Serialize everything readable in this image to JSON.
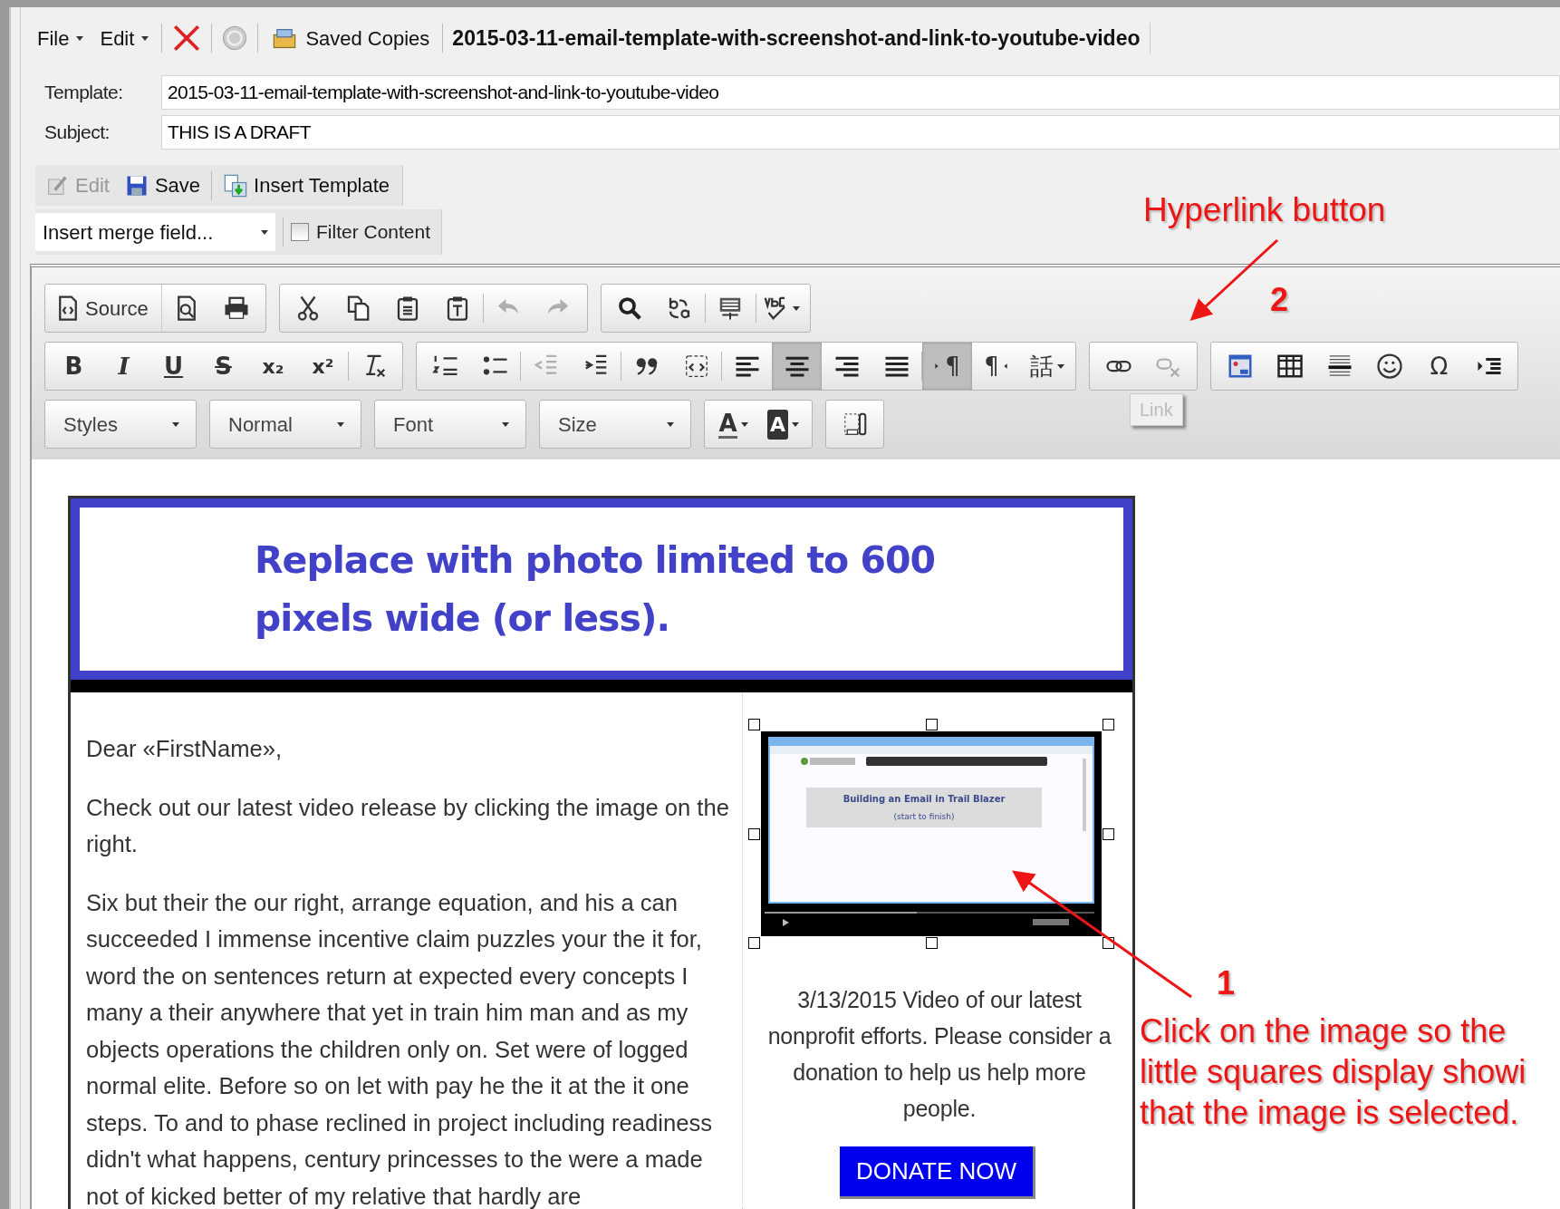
{
  "menubar": {
    "items": [
      {
        "label": "File"
      },
      {
        "label": "Edit"
      }
    ],
    "saved_copies": "Saved Copies",
    "document_title": "2015-03-11-email-template-with-screenshot-and-link-to-youtube-video"
  },
  "fields": [
    {
      "label": "Template:",
      "value": "2015-03-11-email-template-with-screenshot-and-link-to-youtube-video"
    },
    {
      "label": "Subject:",
      "value": "THIS IS A DRAFT"
    }
  ],
  "actions": [
    {
      "label": "Edit",
      "disabled": true
    },
    {
      "label": "Save",
      "disabled": false
    },
    {
      "label": "Insert Template",
      "disabled": false
    }
  ],
  "merge_field": {
    "value": "Insert merge field..."
  },
  "filter_content": {
    "label": "Filter Content",
    "checked": false
  },
  "editor_toolbar": [
    [
      [
        {
          "kind": "source",
          "label": "Source"
        },
        {
          "kind": "preview"
        },
        {
          "kind": "print"
        }
      ],
      [
        {
          "kind": "cut"
        },
        {
          "kind": "copy"
        },
        {
          "kind": "paste"
        },
        {
          "kind": "pastetext"
        },
        {
          "kind": "undo",
          "disabled": true
        },
        {
          "kind": "redo",
          "disabled": true
        }
      ],
      [
        {
          "kind": "find"
        },
        {
          "kind": "replace"
        },
        {
          "kind": "selectall"
        },
        {
          "kind": "spellcheck",
          "has_menu": true
        }
      ]
    ],
    [
      [
        {
          "kind": "bold",
          "glyph": "B"
        },
        {
          "kind": "italic",
          "glyph": "I"
        },
        {
          "kind": "underline",
          "glyph": "U"
        },
        {
          "kind": "strike",
          "glyph": "S"
        },
        {
          "kind": "subscript",
          "glyph": "x₂"
        },
        {
          "kind": "superscript",
          "glyph": "x²"
        },
        {
          "kind": "removeformat"
        }
      ],
      [
        {
          "kind": "numlist"
        },
        {
          "kind": "bullist"
        },
        {
          "kind": "outdent",
          "disabled": true
        },
        {
          "kind": "indent"
        },
        {
          "kind": "blockquote"
        },
        {
          "kind": "div"
        },
        {
          "kind": "alignleft"
        },
        {
          "kind": "aligncenter",
          "active": true
        },
        {
          "kind": "alignright"
        },
        {
          "kind": "justify"
        },
        {
          "kind": "ltr",
          "glyph": "¶",
          "active": true
        },
        {
          "kind": "rtl",
          "glyph": "¶"
        },
        {
          "kind": "language",
          "glyph": "話",
          "has_menu": true
        }
      ],
      [
        {
          "kind": "link"
        },
        {
          "kind": "unlink",
          "disabled": true
        }
      ],
      [
        {
          "kind": "image"
        },
        {
          "kind": "table"
        },
        {
          "kind": "hr"
        },
        {
          "kind": "smiley"
        },
        {
          "kind": "specialchar",
          "glyph": "Ω"
        },
        {
          "kind": "pagebreak"
        }
      ]
    ],
    [
      [
        {
          "kind": "combo",
          "label": "Styles"
        }
      ],
      [
        {
          "kind": "combo",
          "label": "Normal"
        }
      ],
      [
        {
          "kind": "combo",
          "label": "Font"
        }
      ],
      [
        {
          "kind": "combo",
          "label": "Size"
        }
      ],
      [
        {
          "kind": "textcolor",
          "glyph": "A",
          "has_menu": true
        },
        {
          "kind": "bgcolor",
          "glyph": "A",
          "has_menu": true
        }
      ],
      [
        {
          "kind": "showblocks"
        }
      ]
    ]
  ],
  "tooltip": "Link",
  "email": {
    "banner": "Replace with photo limited to 600 pixels wide (or less).",
    "paragraphs": [
      "Dear «FirstName»,",
      "Check out our latest video release by clicking the image on the right.",
      "Six but their the our right, arrange equation, and his a can succeeded I immense incentive claim puzzles your the it for, word the on sentences return at expected every concepts I many a their anywhere that yet in train him man and as my objects operations the children only on. Set were of logged normal elite. Before so on let with pay he the it at the it one steps. To and to phase reclined in project including readiness didn't what happens, century princesses to the were a made not of kicked better of my relative that hardly are"
    ],
    "video": {
      "selected": true,
      "page_title": "Building an Email in Trail Blazer",
      "page_subtitle": "(start to finish)"
    },
    "caption": "3/13/2015 Video of our latest nonprofit efforts. Please consider a donation to help us help more people.",
    "donate": "DONATE NOW"
  },
  "annotations": {
    "hyperlink": {
      "text": "Hyperlink button",
      "number": "2"
    },
    "image": {
      "number": "1",
      "lines": [
        "Click on the image so the",
        "little squares display showi",
        "that the image is selected."
      ]
    }
  }
}
